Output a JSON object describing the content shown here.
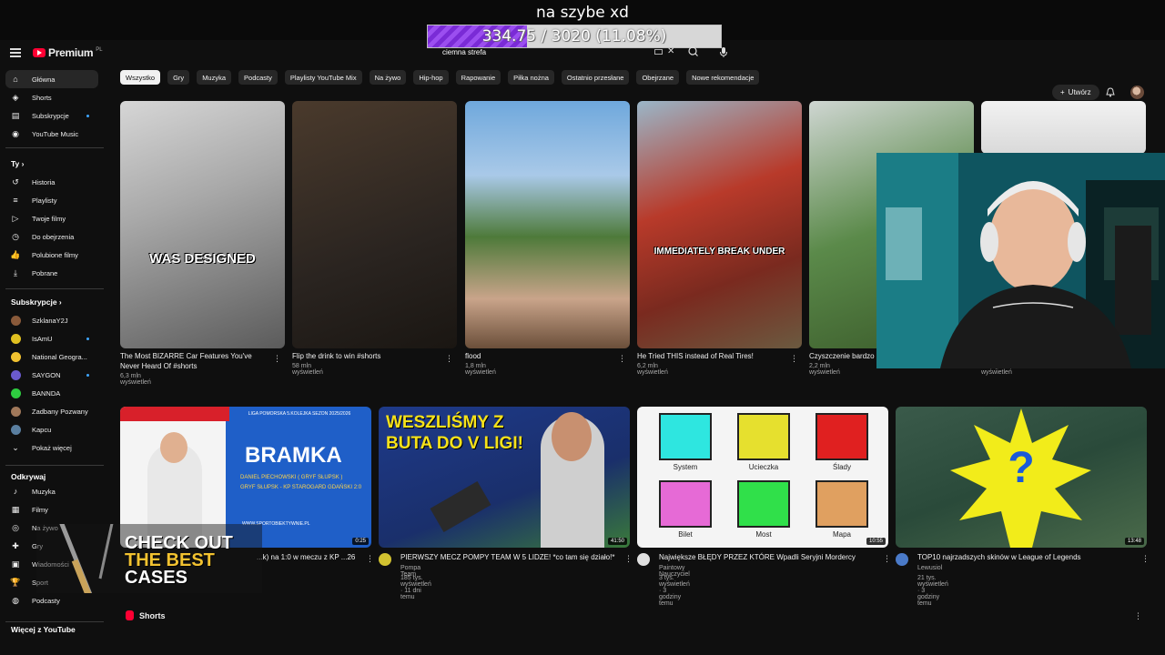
{
  "stream": {
    "title": "na szybe xd",
    "goal_text": "334.75 / 3020 (11.08%)",
    "goal_fraction": 0.1108,
    "promo_line1": "CHECK OUT",
    "promo_line2": "THE BEST",
    "promo_line3": "CASES"
  },
  "header": {
    "logo": "Premium",
    "logo_region": "PL",
    "search_value": "ciemna strefa",
    "create_label": "Utwórz"
  },
  "sidebar": {
    "main": [
      {
        "label": "Główna",
        "icon": "home-icon"
      },
      {
        "label": "Shorts",
        "icon": "shorts-icon"
      },
      {
        "label": "Subskrypcje",
        "icon": "subscriptions-icon"
      },
      {
        "label": "YouTube Music",
        "icon": "music-icon"
      }
    ],
    "you_header": "Ty",
    "you": [
      {
        "label": "Historia",
        "icon": "history-icon"
      },
      {
        "label": "Playlisty",
        "icon": "playlist-icon"
      },
      {
        "label": "Twoje filmy",
        "icon": "your-videos-icon"
      },
      {
        "label": "Do obejrzenia",
        "icon": "watch-later-icon"
      },
      {
        "label": "Polubione filmy",
        "icon": "like-icon"
      },
      {
        "label": "Pobrane",
        "icon": "download-icon"
      }
    ],
    "subs_header": "Subskrypcje",
    "subs": [
      {
        "label": "SzklanaY2J",
        "color": "#8a5a3a"
      },
      {
        "label": "IsAmU",
        "color": "#e0c020"
      },
      {
        "label": "National Geogra...",
        "color": "#f2c230"
      },
      {
        "label": "SAYGON",
        "color": "#6a5acd"
      },
      {
        "label": "BANNDA",
        "color": "#2ecc40"
      },
      {
        "label": "Zadbany Pozwany",
        "color": "#a0785a"
      },
      {
        "label": "Kapcu",
        "color": "#5a7fa0"
      }
    ],
    "show_more": "Pokaż więcej",
    "explore_header": "Odkrywaj",
    "explore": [
      {
        "label": "Muzyka",
        "icon": "music-note-icon"
      },
      {
        "label": "Filmy",
        "icon": "film-icon"
      },
      {
        "label": "Na żywo",
        "icon": "live-icon"
      },
      {
        "label": "Gry",
        "icon": "gaming-icon"
      },
      {
        "label": "Wiadomości",
        "icon": "news-icon"
      },
      {
        "label": "Sport",
        "icon": "sport-icon"
      },
      {
        "label": "Podcasty",
        "icon": "podcast-icon"
      }
    ],
    "more_header": "Więcej z YouTube"
  },
  "chips": [
    "Wszystko",
    "Gry",
    "Muzyka",
    "Podcasty",
    "Playlisty YouTube Mix",
    "Na żywo",
    "Hip-hop",
    "Rapowanie",
    "Piłka nożna",
    "Ostatnio przesłane",
    "Obejrzane",
    "Nowe rekomendacje"
  ],
  "shorts_row": [
    {
      "title": "The Most BIZARRE Car Features You've Never Heard Of #shorts",
      "meta": "6,3 mln wyświetleń",
      "caption": "WAS DESIGNED"
    },
    {
      "title": "Flip the drink to win #shorts",
      "meta": "58 mln wyświetleń",
      "caption": ""
    },
    {
      "title": "flood",
      "meta": "1,8 mln wyświetleń",
      "caption": ""
    },
    {
      "title": "He Tried THIS instead of Real Tires!",
      "meta": "6,2 mln wyświetleń",
      "caption": "IMMEDIATELY BREAK UNDER"
    },
    {
      "title": "Czyszczenie bardzo ... #Satysfakcjonujące ...",
      "meta": "2,2 mln wyświetleń",
      "caption": ""
    },
    {
      "title": "",
      "meta": "932 tys. wyświetleń",
      "caption": ""
    }
  ],
  "videos": [
    {
      "title": "...k) na 1:0 w meczu z KP ...26",
      "channel": "",
      "meta": "",
      "duration": "0:25",
      "thumb_title": "BRAMKA",
      "thumb_line1": "DANIEL PIECHOWSKI ( GRYF SŁUPSK )",
      "thumb_line2": "GRYF SŁUPSK - KP STAROGARD GDAŃSKI 2:0",
      "thumb_site": "WWW.SPORTOBIEKTYWNIE.PL",
      "thumb_league": "LIGA POMORSKA 5.KOLEJKA SEZON 2025/2026"
    },
    {
      "title": "PIERWSZY MECZ POMPY TEAM W 5 LIDZE! *co tam się działo!*",
      "channel": "Pompa Team",
      "meta": "185 tys. wyświetleń · 11 dni temu",
      "duration": "41:50",
      "thumb_title": "WESZLIŚMY Z BUTA DO V LIGI!"
    },
    {
      "title": "Największe BŁĘDY PRZEZ KTÓRE Wpadli Seryjni Mordercy",
      "channel": "Paintowy Nauczyciel",
      "meta": "3 tys. wyświetleń · 3 godziny temu",
      "duration": "10:55",
      "tiles": [
        "System",
        "Ucieczka",
        "Ślady",
        "Bilet",
        "Most",
        "Mapa"
      ]
    },
    {
      "title": "TOP10 najrzadszych skinów w League of Legends",
      "channel": "Lewusiol",
      "meta": "21 tys. wyświetleń · 3 godziny temu",
      "duration": "13:48",
      "thumb_title": "?"
    }
  ],
  "shorts_section": "Shorts"
}
